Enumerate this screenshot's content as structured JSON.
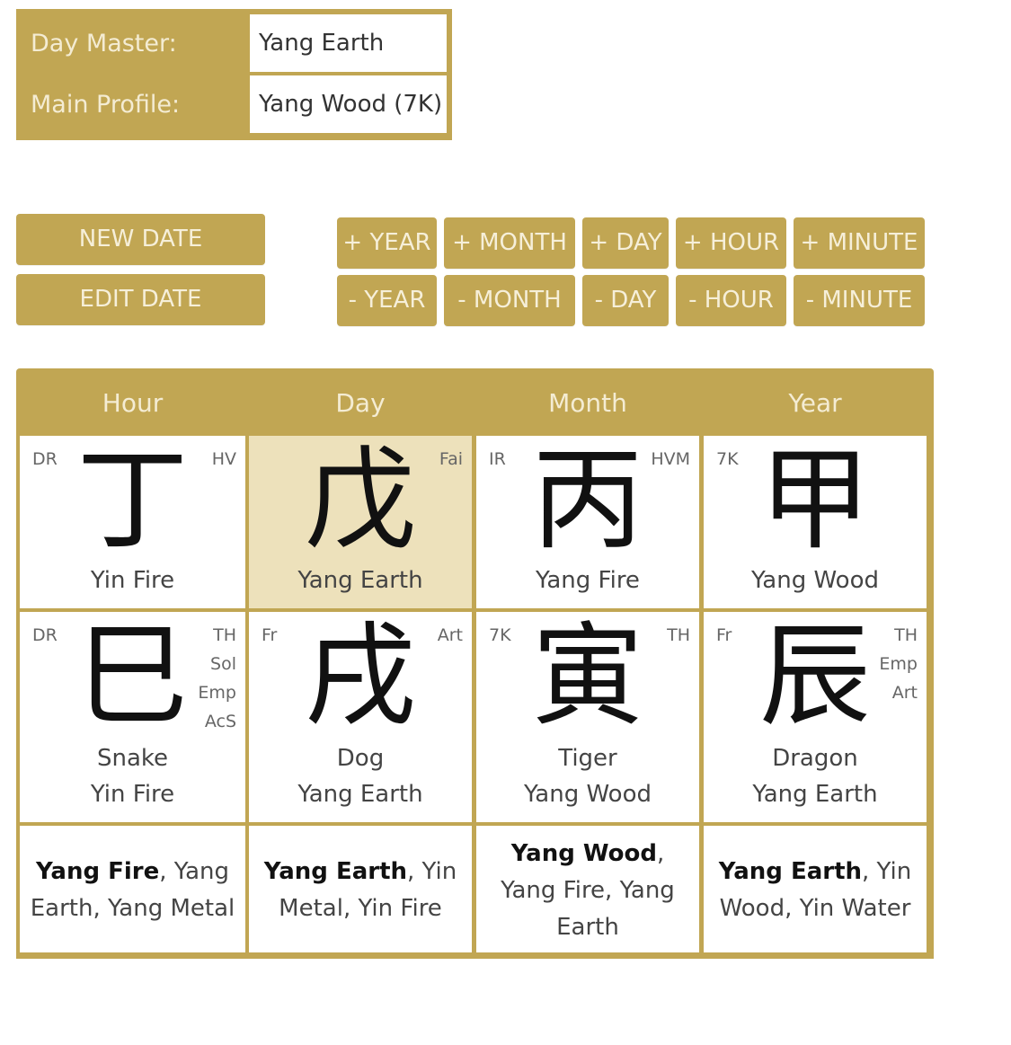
{
  "profile": {
    "day_master_label": "Day Master:",
    "day_master_value": "Yang Earth",
    "main_profile_label": "Main Profile:",
    "main_profile_value": "Yang Wood (7K)"
  },
  "buttons": {
    "new_date": "NEW DATE",
    "edit_date": "EDIT DATE",
    "plus": [
      "+ YEAR",
      "+ MONTH",
      "+ DAY",
      "+ HOUR",
      "+ MINUTE"
    ],
    "minus": [
      "- YEAR",
      "- MONTH",
      "- DAY",
      "- HOUR",
      "- MINUTE"
    ]
  },
  "chart": {
    "headers": [
      "Hour",
      "Day",
      "Month",
      "Year"
    ],
    "stems": [
      {
        "char": "丁",
        "tl": "DR",
        "tr": [
          "HV"
        ],
        "element": "Yin Fire"
      },
      {
        "char": "戊",
        "tl": "",
        "tr": [
          "Fai"
        ],
        "element": "Yang Earth"
      },
      {
        "char": "丙",
        "tl": "IR",
        "tr": [
          "HVM"
        ],
        "element": "Yang Fire"
      },
      {
        "char": "甲",
        "tl": "7K",
        "tr": [],
        "element": "Yang Wood"
      }
    ],
    "branches": [
      {
        "char": "巳",
        "tl": "DR",
        "tr": [
          "TH",
          "Sol",
          "Emp",
          "AcS"
        ],
        "animal": "Snake",
        "element": "Yin Fire"
      },
      {
        "char": "戌",
        "tl": "Fr",
        "tr": [
          "Art"
        ],
        "animal": "Dog",
        "element": "Yang Earth"
      },
      {
        "char": "寅",
        "tl": "7K",
        "tr": [
          "TH"
        ],
        "animal": "Tiger",
        "element": "Yang Wood"
      },
      {
        "char": "辰",
        "tl": "Fr",
        "tr": [
          "TH",
          "Emp",
          "Art"
        ],
        "animal": "Dragon",
        "element": "Yang Earth"
      }
    ],
    "hidden_stems": [
      {
        "main": "Yang Fire",
        "rest": ", Yang Earth, Yang Metal"
      },
      {
        "main": "Yang Earth",
        "rest": ", Yin Metal, Yin Fire"
      },
      {
        "main": "Yang Wood",
        "rest": ", Yang Fire, Yang Earth"
      },
      {
        "main": "Yang Earth",
        "rest": ", Yin Wood, Yin Water"
      }
    ]
  }
}
